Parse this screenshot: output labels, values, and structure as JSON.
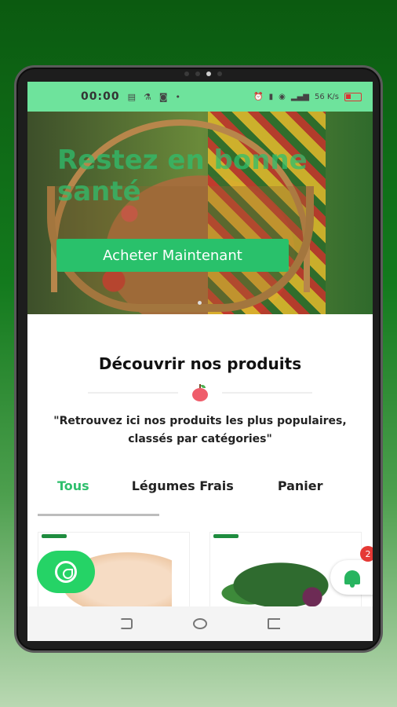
{
  "statusbar": {
    "time": "00:00",
    "network_speed": "56 K/s"
  },
  "hero": {
    "title": "Restez en bonne santé",
    "cta_label": "Acheter Maintenant"
  },
  "section": {
    "title": "Découvrir nos produits",
    "subtitle": "\"Retrouvez ici nos produits les plus populaires, classés par catégories\""
  },
  "tabs": [
    {
      "label": "Tous",
      "active": true
    },
    {
      "label": "Légumes Frais",
      "active": false
    },
    {
      "label": "Panier",
      "active": false
    }
  ],
  "notifications": {
    "count": "2"
  },
  "colors": {
    "accent": "#2fbf6d",
    "statusbar": "#6ee39c",
    "button": "#29c16b",
    "whatsapp": "#25d366",
    "badge": "#e53935"
  },
  "icons": [
    "whatsapp-icon",
    "bell-icon",
    "apple-icon",
    "nav-back-icon",
    "nav-home-icon",
    "nav-recent-icon"
  ]
}
